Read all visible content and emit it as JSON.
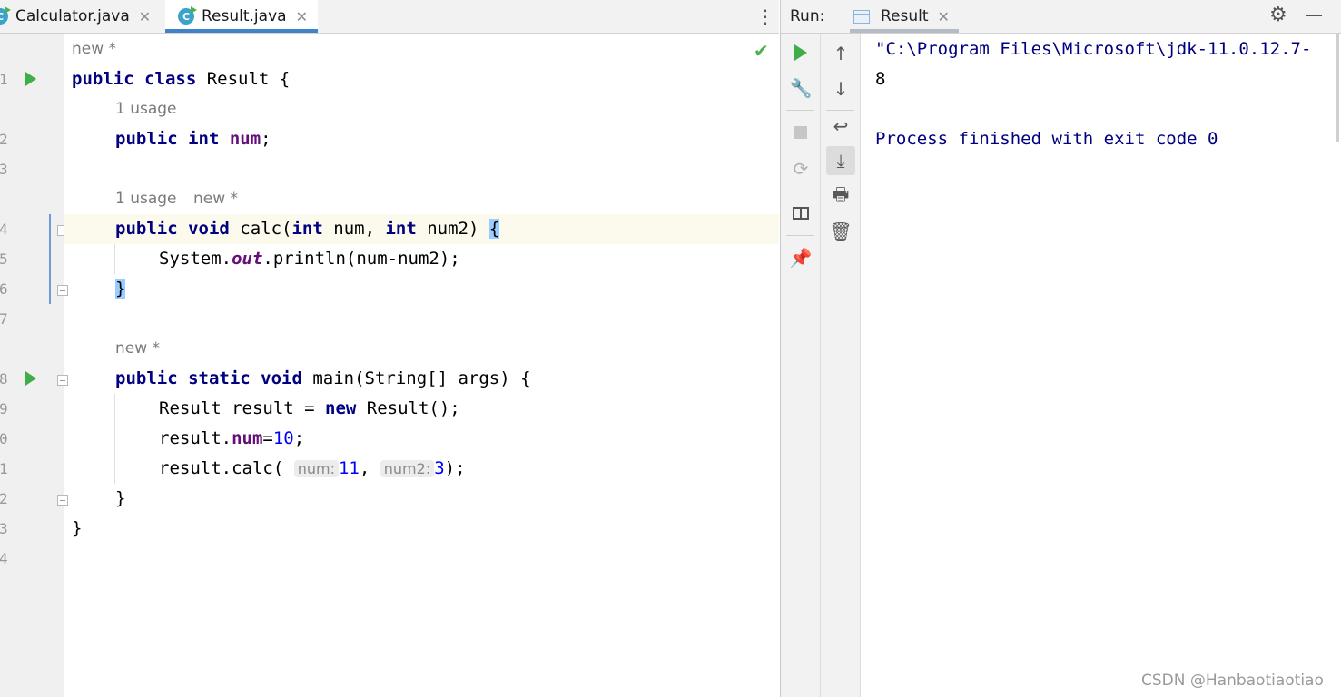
{
  "editor": {
    "tabs": [
      {
        "label": "Calculator.java",
        "icon": "java-class-icon"
      },
      {
        "label": "Result.java",
        "icon": "java-class-icon",
        "active": true
      }
    ],
    "line_numbers": [
      "1",
      "2",
      "3",
      "4",
      "5",
      "6",
      "7",
      "8",
      "9",
      "0",
      "1",
      "2",
      "3",
      "4"
    ],
    "hints": {
      "h1": "new *",
      "h2": "1 usage",
      "h3a": "1 usage",
      "h3b": "new *",
      "h4": "new *"
    },
    "code": {
      "l1a": "public class",
      "l1b": " Result {",
      "l2a": "public int ",
      "l2b": "num",
      "l2c": ";",
      "l4a": "public void",
      "l4b": " calc(",
      "l4c": "int",
      "l4d": " num, ",
      "l4e": "int",
      "l4f": " num2) ",
      "l4g": "{",
      "l5a": "System.",
      "l5b": "out",
      "l5c": ".println(num-num2);",
      "l6": "}",
      "l8a": "public static void",
      "l8b": " main(String[] args) {",
      "l9a": "Result result = ",
      "l9b": "new",
      "l9c": " Result();",
      "l10a": "result.",
      "l10b": "num",
      "l10c": "=",
      "l10d": "10",
      "l10e": ";",
      "l11a": "result.calc( ",
      "l11b": "num:",
      "l11c": "11",
      "l11d": ", ",
      "l11e": "num2:",
      "l11f": "3",
      "l11g": ");",
      "l12": "}",
      "l13": "}"
    }
  },
  "run_panel": {
    "label": "Run:",
    "tab_label": "Result",
    "console_lines": [
      "\"C:\\Program Files\\Microsoft\\jdk-11.0.12.7-",
      "8",
      "",
      "Process finished with exit code 0"
    ],
    "console_color": "#000080"
  },
  "watermark": "CSDN @Hanbaotiaotiao",
  "colors": {
    "keyword": "#000080",
    "field": "#660e7a",
    "number": "#0000ff",
    "run_green": "#3fae49",
    "tab_underline": "#4083c9"
  }
}
